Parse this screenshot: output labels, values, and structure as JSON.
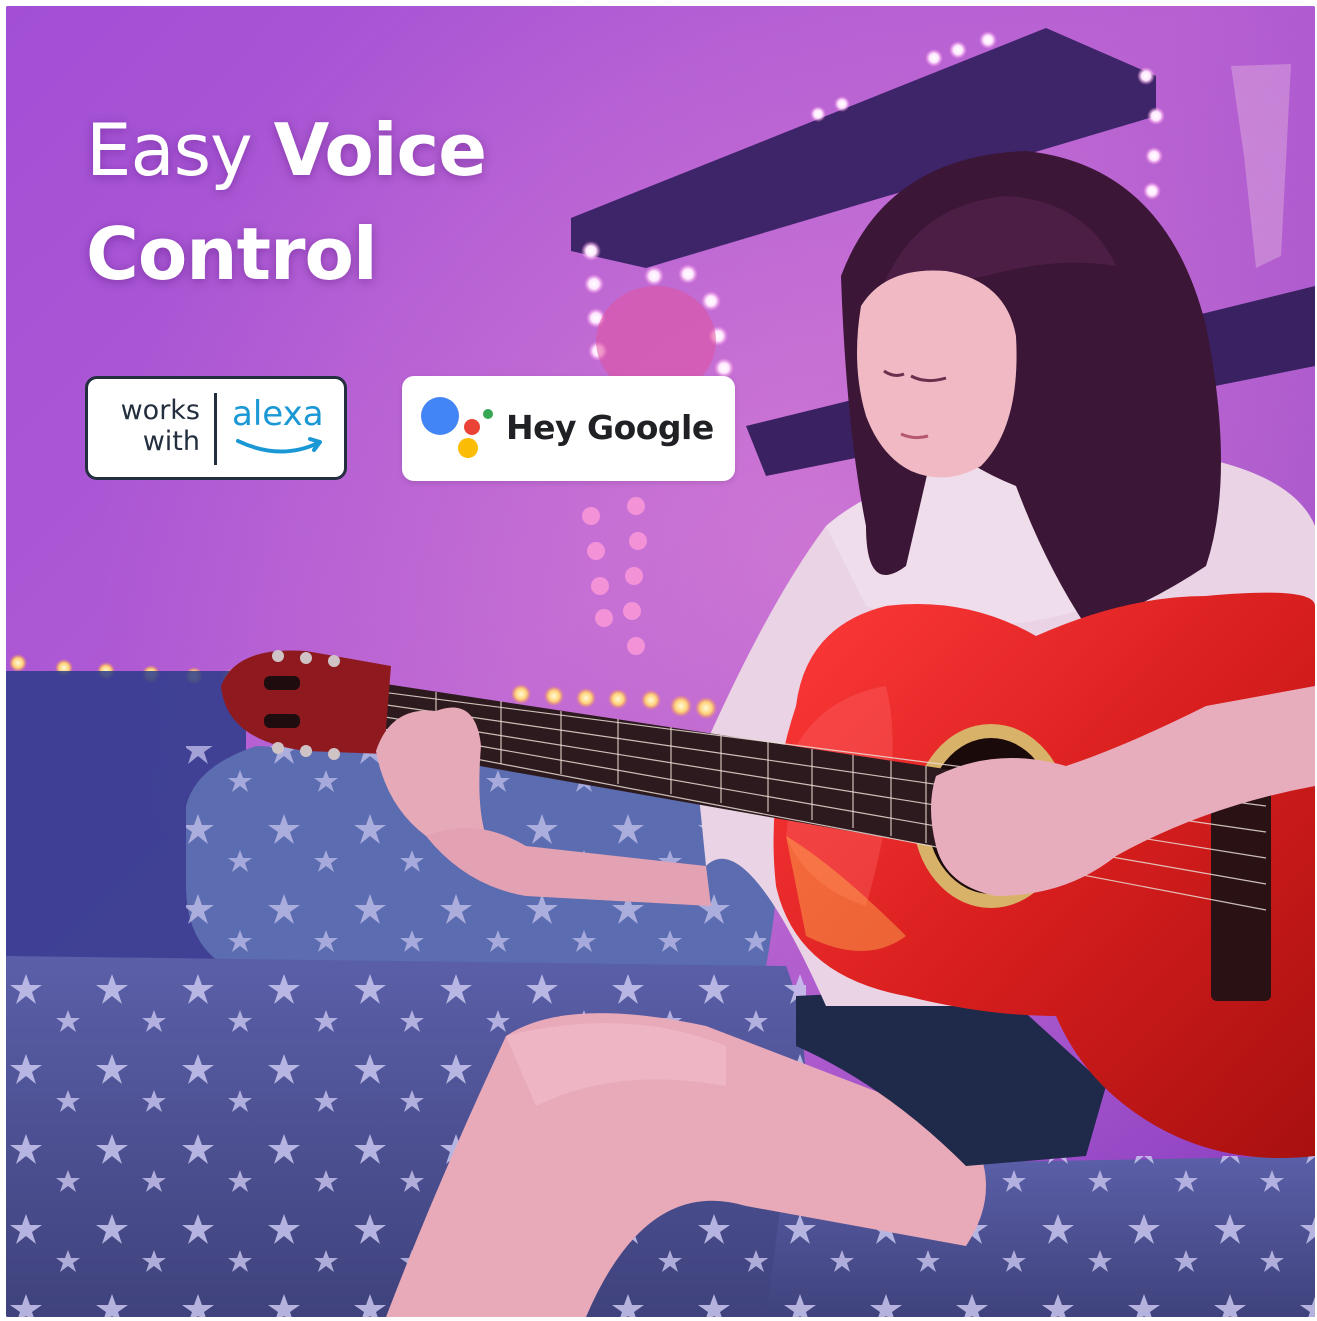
{
  "headline": {
    "line1_light": "Easy ",
    "line1_bold": "Voice",
    "line2_bold": "Control"
  },
  "badges": {
    "alexa": {
      "line1": "works",
      "line2": "with",
      "brand": "alexa"
    },
    "google": {
      "text": "Hey Google"
    }
  },
  "colors": {
    "alexa_blue": "#1a98d5",
    "alexa_dark": "#232f3e",
    "google_blue": "#4285f4",
    "google_red": "#ea4335",
    "google_yellow": "#fbbc05",
    "google_green": "#34a853",
    "guitar_red": "#d81e1e",
    "ambient_purple": "#9a4bd0"
  },
  "icons": {
    "alexa_logo": "alexa-smile-icon",
    "google_logo": "google-assistant-dots-icon"
  }
}
